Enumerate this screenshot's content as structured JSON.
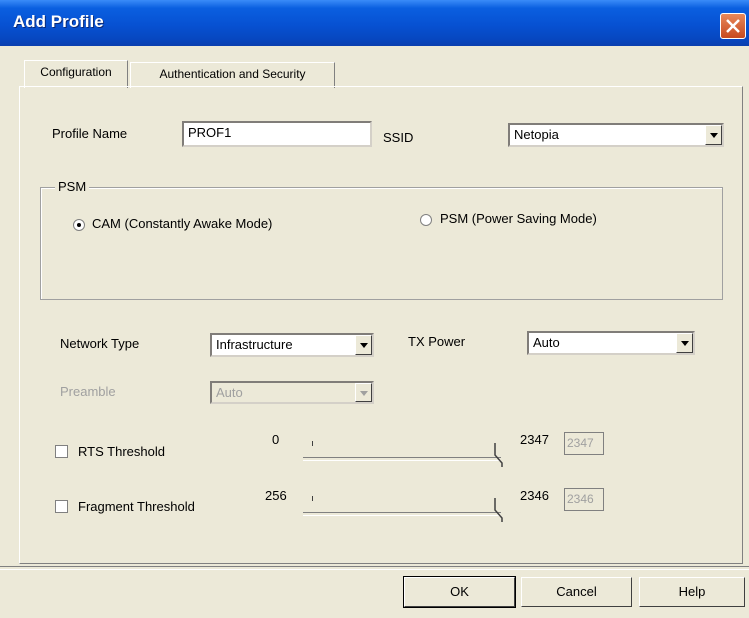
{
  "window": {
    "title": "Add Profile",
    "close_icon": "close-icon"
  },
  "tabs": [
    {
      "label": "Configuration",
      "selected": true
    },
    {
      "label": "Authentication and Security",
      "selected": false
    }
  ],
  "profile": {
    "name_label": "Profile Name",
    "name_value": "PROF1",
    "ssid_label": "SSID",
    "ssid_value": "Netopia"
  },
  "psm": {
    "group_label": "PSM",
    "options": [
      {
        "label": "CAM (Constantly Awake Mode)",
        "selected": true
      },
      {
        "label": "PSM (Power Saving Mode)",
        "selected": false
      }
    ]
  },
  "network": {
    "type_label": "Network Type",
    "type_value": "Infrastructure",
    "tx_label": "TX Power",
    "tx_value": "Auto",
    "preamble_label": "Preamble",
    "preamble_value": "Auto"
  },
  "rts": {
    "label": "RTS Threshold",
    "checked": false,
    "min": "0",
    "max": "2347",
    "value": "2347",
    "slider_fraction": 1.0
  },
  "fragment": {
    "label": "Fragment Threshold",
    "checked": false,
    "min": "256",
    "max": "2346",
    "value": "2346",
    "slider_fraction": 1.0
  },
  "buttons": {
    "ok": "OK",
    "cancel": "Cancel",
    "help": "Help"
  }
}
